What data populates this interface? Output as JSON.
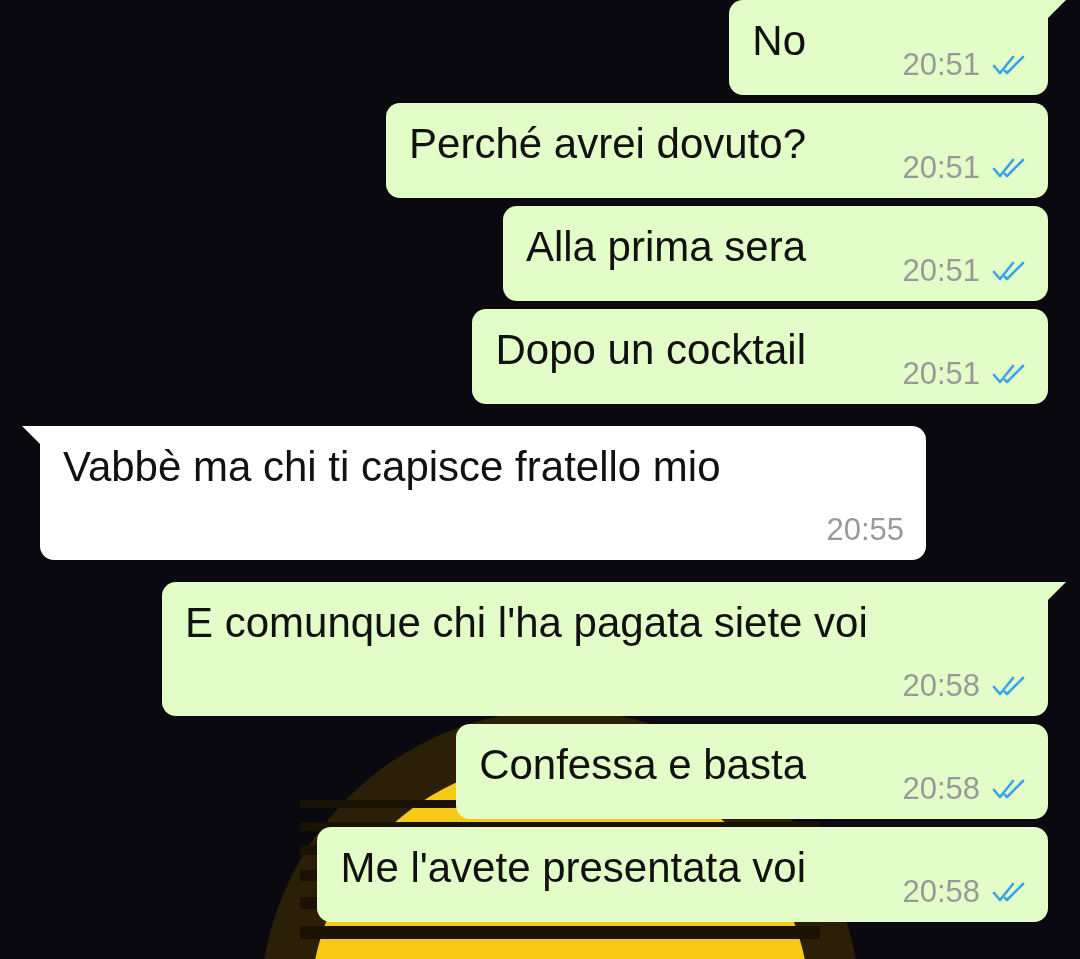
{
  "messages": [
    {
      "kind": "sent",
      "tail": true,
      "text": "No",
      "time": "20:51",
      "read": true
    },
    {
      "kind": "sent",
      "tail": false,
      "text": "Perché avrei dovuto?",
      "time": "20:51",
      "read": true
    },
    {
      "kind": "sent",
      "tail": false,
      "text": "Alla prima sera",
      "time": "20:51",
      "read": true
    },
    {
      "kind": "sent",
      "tail": false,
      "text": "Dopo un cocktail",
      "time": "20:51",
      "read": true
    },
    {
      "kind": "received",
      "tail": true,
      "text": "Vabbè ma chi ti capisce fratello mio",
      "time": "20:55"
    },
    {
      "kind": "sent",
      "tail": true,
      "text": "E comunque chi l'ha pagata siete voi",
      "time": "20:58",
      "read": true
    },
    {
      "kind": "sent",
      "tail": false,
      "text": "Confessa e basta",
      "time": "20:58",
      "read": true
    },
    {
      "kind": "sent",
      "tail": false,
      "text": "Me l'avete presentata voi",
      "time": "20:58",
      "read": true
    }
  ]
}
